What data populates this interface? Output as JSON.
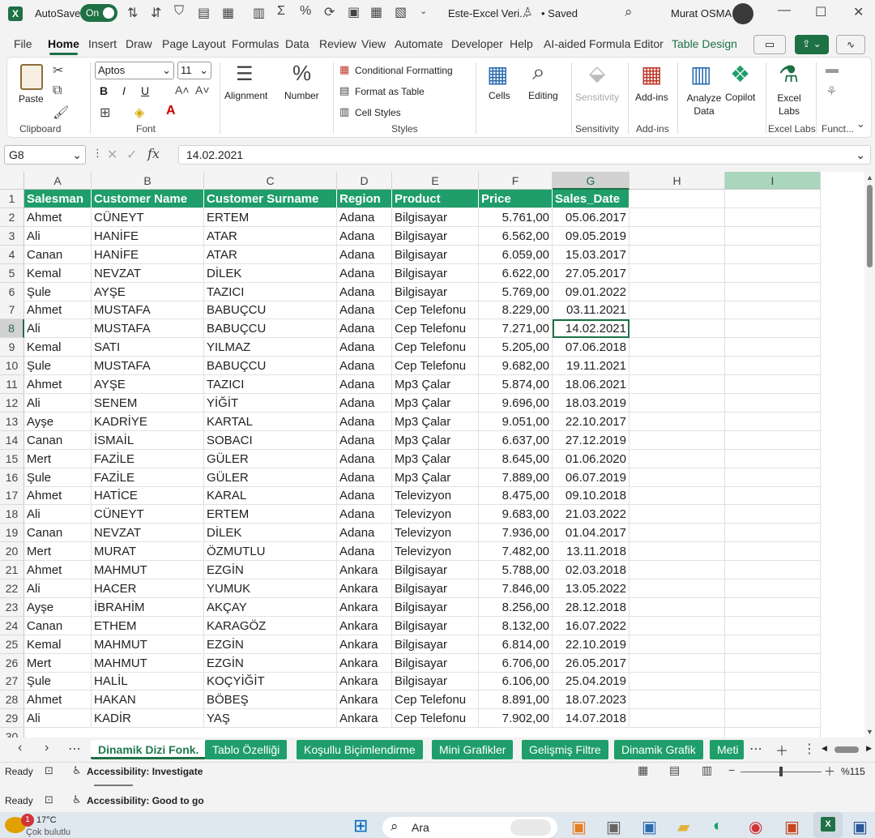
{
  "titlebar": {
    "autosave_label": "AutoSave",
    "autosave_state": "On",
    "filename": "Este-Excel Veri...",
    "saved": "• Saved",
    "user": "Murat OSMA"
  },
  "tabs": [
    "File",
    "Home",
    "Insert",
    "Draw",
    "Page Layout",
    "Formulas",
    "Data",
    "Review",
    "View",
    "Automate",
    "Developer",
    "Help",
    "AI-aided Formula Editor",
    "Table Design"
  ],
  "active_tab": "Home",
  "ribbon": {
    "paste": "Paste",
    "clipboard": "Clipboard",
    "font_name": "Aptos",
    "font_size": "11",
    "font": "Font",
    "alignment": "Alignment",
    "number": "Number",
    "conditional_formatting": "Conditional Formatting",
    "format_as_table": "Format as Table",
    "cell_styles": "Cell Styles",
    "styles": "Styles",
    "cells": "Cells",
    "editing": "Editing",
    "sensitivity": "Sensitivity",
    "sensitivity_group": "Sensitivity",
    "addins": "Add-ins",
    "addins_group": "Add-ins",
    "analyze_data": "Analyze Data",
    "copilot": "Copilot",
    "excel_labs": "Excel Labs",
    "excel_labs_group": "Excel Labs",
    "funct_group": "Funct...",
    "bold": "B",
    "italic": "I",
    "underline": "U"
  },
  "formula_bar": {
    "name_box": "G8",
    "formula": "14.02.2021"
  },
  "columns": [
    "A",
    "B",
    "C",
    "D",
    "E",
    "F",
    "G",
    "H",
    "I"
  ],
  "table": {
    "headers": [
      "Salesman",
      "Customer Name",
      "Customer Surname",
      "Region",
      "Product",
      "Price",
      "Sales_Date"
    ],
    "rows": [
      [
        "Ahmet",
        "CÜNEYT",
        "ERTEM",
        "Adana",
        "Bilgisayar",
        "5.761,00",
        "05.06.2017"
      ],
      [
        "Ali",
        "HANİFE",
        "ATAR",
        "Adana",
        "Bilgisayar",
        "6.562,00",
        "09.05.2019"
      ],
      [
        "Canan",
        "HANİFE",
        "ATAR",
        "Adana",
        "Bilgisayar",
        "6.059,00",
        "15.03.2017"
      ],
      [
        "Kemal",
        "NEVZAT",
        "DİLEK",
        "Adana",
        "Bilgisayar",
        "6.622,00",
        "27.05.2017"
      ],
      [
        "Şule",
        "AYŞE",
        "TAZICI",
        "Adana",
        "Bilgisayar",
        "5.769,00",
        "09.01.2022"
      ],
      [
        "Ahmet",
        "MUSTAFA",
        "BABUÇCU",
        "Adana",
        "Cep Telefonu",
        "8.229,00",
        "03.11.2021"
      ],
      [
        "Ali",
        "MUSTAFA",
        "BABUÇCU",
        "Adana",
        "Cep Telefonu",
        "7.271,00",
        "14.02.2021"
      ],
      [
        "Kemal",
        "SATI",
        "YILMAZ",
        "Adana",
        "Cep Telefonu",
        "5.205,00",
        "07.06.2018"
      ],
      [
        "Şule",
        "MUSTAFA",
        "BABUÇCU",
        "Adana",
        "Cep Telefonu",
        "9.682,00",
        "19.11.2021"
      ],
      [
        "Ahmet",
        "AYŞE",
        "TAZICI",
        "Adana",
        "Mp3 Çalar",
        "5.874,00",
        "18.06.2021"
      ],
      [
        "Ali",
        "SENEM",
        "YİĞİT",
        "Adana",
        "Mp3 Çalar",
        "9.696,00",
        "18.03.2019"
      ],
      [
        "Ayşe",
        "KADRİYE",
        "KARTAL",
        "Adana",
        "Mp3 Çalar",
        "9.051,00",
        "22.10.2017"
      ],
      [
        "Canan",
        "İSMAİL",
        "SOBACI",
        "Adana",
        "Mp3 Çalar",
        "6.637,00",
        "27.12.2019"
      ],
      [
        "Mert",
        "FAZİLE",
        "GÜLER",
        "Adana",
        "Mp3 Çalar",
        "8.645,00",
        "01.06.2020"
      ],
      [
        "Şule",
        "FAZİLE",
        "GÜLER",
        "Adana",
        "Mp3 Çalar",
        "7.889,00",
        "06.07.2019"
      ],
      [
        "Ahmet",
        "HATİCE",
        "KARAL",
        "Adana",
        "Televizyon",
        "8.475,00",
        "09.10.2018"
      ],
      [
        "Ali",
        "CÜNEYT",
        "ERTEM",
        "Adana",
        "Televizyon",
        "9.683,00",
        "21.03.2022"
      ],
      [
        "Canan",
        "NEVZAT",
        "DİLEK",
        "Adana",
        "Televizyon",
        "7.936,00",
        "01.04.2017"
      ],
      [
        "Mert",
        "MURAT",
        "ÖZMUTLU",
        "Adana",
        "Televizyon",
        "7.482,00",
        "13.11.2018"
      ],
      [
        "Ahmet",
        "MAHMUT",
        "EZGİN",
        "Ankara",
        "Bilgisayar",
        "5.788,00",
        "02.03.2018"
      ],
      [
        "Ali",
        "HACER",
        "YUMUK",
        "Ankara",
        "Bilgisayar",
        "7.846,00",
        "13.05.2022"
      ],
      [
        "Ayşe",
        "İBRAHİM",
        "AKÇAY",
        "Ankara",
        "Bilgisayar",
        "8.256,00",
        "28.12.2018"
      ],
      [
        "Canan",
        "ETHEM",
        "KARAGÖZ",
        "Ankara",
        "Bilgisayar",
        "8.132,00",
        "16.07.2022"
      ],
      [
        "Kemal",
        "MAHMUT",
        "EZGİN",
        "Ankara",
        "Bilgisayar",
        "6.814,00",
        "22.10.2019"
      ],
      [
        "Mert",
        "MAHMUT",
        "EZGİN",
        "Ankara",
        "Bilgisayar",
        "6.706,00",
        "26.05.2017"
      ],
      [
        "Şule",
        "HALİL",
        "KOÇYİĞİT",
        "Ankara",
        "Bilgisayar",
        "6.106,00",
        "25.04.2019"
      ],
      [
        "Ahmet",
        "HAKAN",
        "BÖBEŞ",
        "Ankara",
        "Cep Telefonu",
        "8.891,00",
        "18.07.2023"
      ],
      [
        "Ali",
        "KADİR",
        "YAŞ",
        "Ankara",
        "Cep Telefonu",
        "7.902,00",
        "14.07.2018"
      ]
    ]
  },
  "selected_cell": {
    "row": 8,
    "col": "G"
  },
  "sheet_tabs": [
    "Dinamik Dizi Fonk.",
    "Tablo Özelliği",
    "Koşullu Biçimlendirme",
    "Mini Grafikler",
    "Gelişmiş Filtre",
    "Dinamik Grafik",
    "Meti"
  ],
  "active_sheet": "Dinamik Dizi Fonk.",
  "status": {
    "ready": "Ready",
    "accessibility": "Accessibility: Investigate",
    "zoom": "%115",
    "ready2": "Ready",
    "accessibility2": "Accessibility: Good to go"
  },
  "taskbar": {
    "weather_temp": "17°C",
    "weather_desc": "Çok bulutlu",
    "search": "Ara",
    "badge": "1"
  },
  "colors": {
    "accent": "#1e7145",
    "table_header": "#1f9e6a"
  }
}
